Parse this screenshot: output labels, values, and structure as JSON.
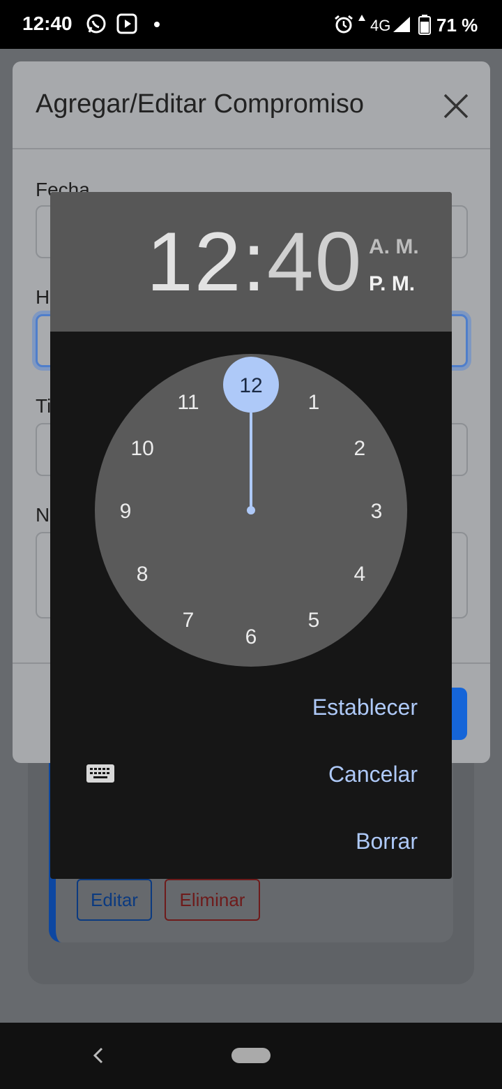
{
  "status_bar": {
    "time": "12:40",
    "network": "4G",
    "battery": "71 %",
    "icons": [
      "whatsapp-icon",
      "youtube-icon",
      "notification-dot-icon",
      "alarm-icon",
      "data-arrow-icon",
      "signal-icon",
      "battery-icon"
    ]
  },
  "modal": {
    "title": "Agregar/Editar Compromiso",
    "fields": [
      {
        "label": "Fecha"
      },
      {
        "label": "Hora"
      },
      {
        "label": "Tipo"
      },
      {
        "label": "Nota"
      }
    ]
  },
  "background_card": {
    "edit_label": "Editar",
    "delete_label": "Eliminar"
  },
  "time_picker": {
    "hour": "12",
    "separator": ":",
    "minute": "40",
    "am_label": "A. M.",
    "pm_label": "P. M.",
    "selected_period": "P. M.",
    "mode": "hour",
    "clock_numbers": [
      "12",
      "1",
      "2",
      "3",
      "4",
      "5",
      "6",
      "7",
      "8",
      "9",
      "10",
      "11"
    ],
    "selected_hour": "12",
    "actions": {
      "set": "Establecer",
      "cancel": "Cancelar",
      "clear": "Borrar"
    }
  },
  "colors": {
    "accent": "#aec9f8",
    "clock_face": "#5a5a5a",
    "header": "#575757",
    "dialog_bg": "#161616"
  }
}
